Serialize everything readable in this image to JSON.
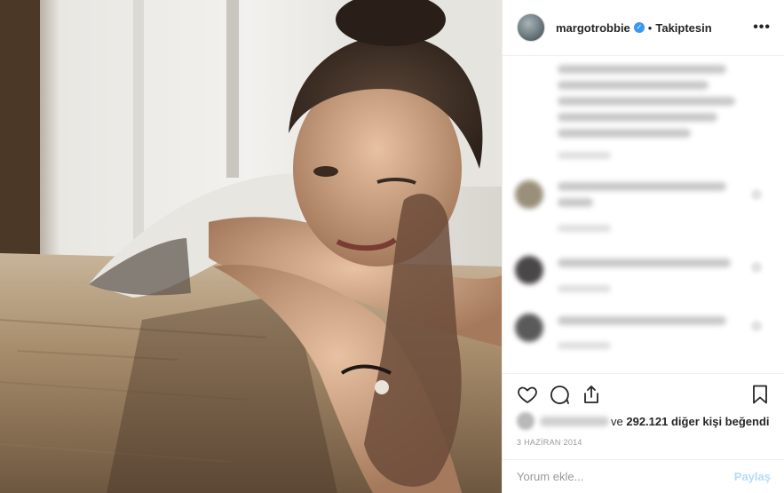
{
  "post": {
    "username": "margotrobbie",
    "verified_badge_icon": "verified-check-icon",
    "separator": "•",
    "follow_state": "Takiptesin",
    "more_icon": "more-options-icon",
    "more_glyph": "•••"
  },
  "actions": {
    "like_icon": "heart-icon",
    "comment_icon": "comment-icon",
    "share_icon": "share-icon",
    "save_icon": "bookmark-icon"
  },
  "likes": {
    "prefix": "ve",
    "count": "292.121",
    "suffix": "diğer kişi beğendi"
  },
  "date": "3 HAZİRAN 2014",
  "comment_box": {
    "placeholder": "Yorum ekle...",
    "post_label": "Paylaş"
  },
  "colors": {
    "link_disabled": "#b3dbff",
    "verified": "#3897f0",
    "muted": "#999999"
  }
}
